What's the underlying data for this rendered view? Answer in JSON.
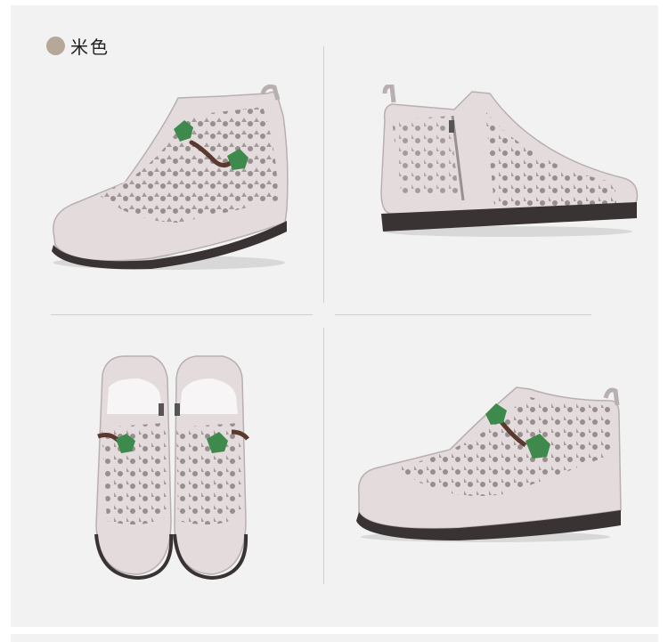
{
  "color_option": {
    "label": "米色",
    "swatch_color": "#b5a898"
  },
  "colors": {
    "shoe_body": "#e3dbdc",
    "shoe_shade": "#cfc5c6",
    "sole": "#3a3333",
    "knot_green": "#3e8a4c",
    "knot_cord": "#5a3a2e"
  },
  "photos": [
    {
      "view": "left-three-quarter"
    },
    {
      "view": "right-side-zip"
    },
    {
      "view": "front-pair"
    },
    {
      "view": "right-three-quarter"
    }
  ]
}
